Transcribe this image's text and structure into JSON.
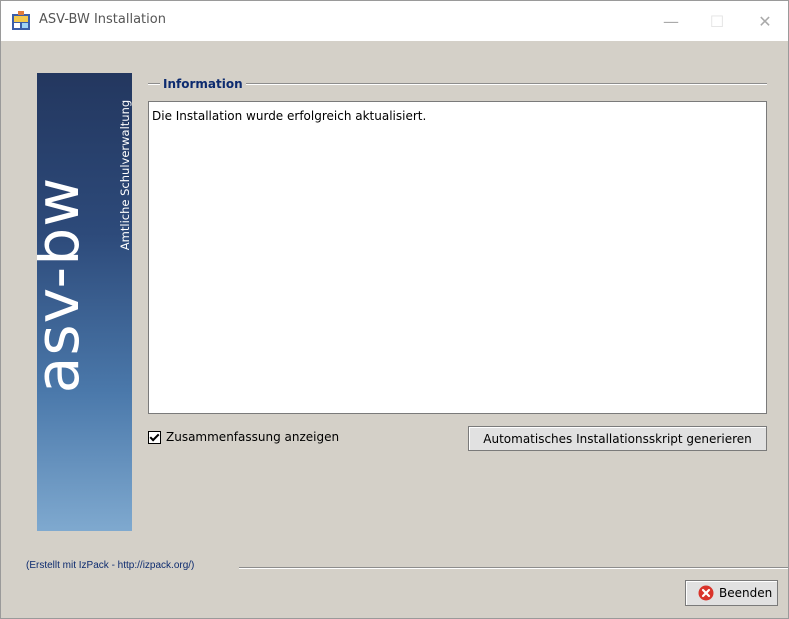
{
  "window": {
    "title": "ASV-BW Installation",
    "minimize_glyph": "—",
    "maximize_glyph": "☐",
    "close_glyph": "✕"
  },
  "logo": {
    "main": "asv-bw",
    "sub": "Amtliche Schulverwaltung"
  },
  "info": {
    "group_title": "Information",
    "message": "Die Installation wurde erfolgreich aktualisiert."
  },
  "summary_checkbox": {
    "label": "Zusammenfassung anzeigen",
    "checked": true
  },
  "buttons": {
    "generate_script": "Automatisches Installationsskript generieren",
    "quit": "Beenden"
  },
  "footer": {
    "text": "(Erstellt mit IzPack - http://izpack.org/)"
  },
  "colors": {
    "title_blue": "#0d2b6f",
    "panel_bg": "#d4d0c8",
    "quit_icon_red": "#d9342b"
  },
  "icons": {
    "app": "installer-icon",
    "quit": "red-x-icon"
  }
}
